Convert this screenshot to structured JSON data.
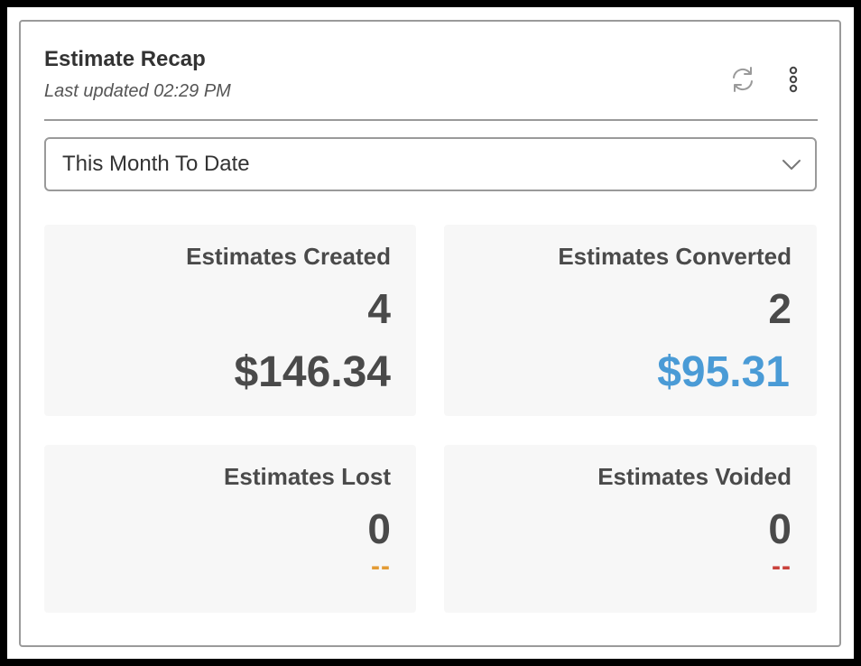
{
  "widget": {
    "title": "Estimate Recap",
    "last_updated": "Last updated 02:29 PM",
    "refresh_icon": "refresh-icon",
    "menu_icon": "more-vertical-icon"
  },
  "filter": {
    "selected": "This Month To Date",
    "chevron_icon": "chevron-down-icon"
  },
  "tiles": {
    "created": {
      "label": "Estimates Created",
      "count": "4",
      "amount": "$146.34",
      "amount_color": "#4a4a4a"
    },
    "converted": {
      "label": "Estimates Converted",
      "count": "2",
      "amount": "$95.31",
      "amount_color": "#4a9bd6"
    },
    "lost": {
      "label": "Estimates Lost",
      "count": "0",
      "amount": "--",
      "amount_color": "#e39b35"
    },
    "voided": {
      "label": "Estimates Voided",
      "count": "0",
      "amount": "--",
      "amount_color": "#c9423c"
    }
  }
}
